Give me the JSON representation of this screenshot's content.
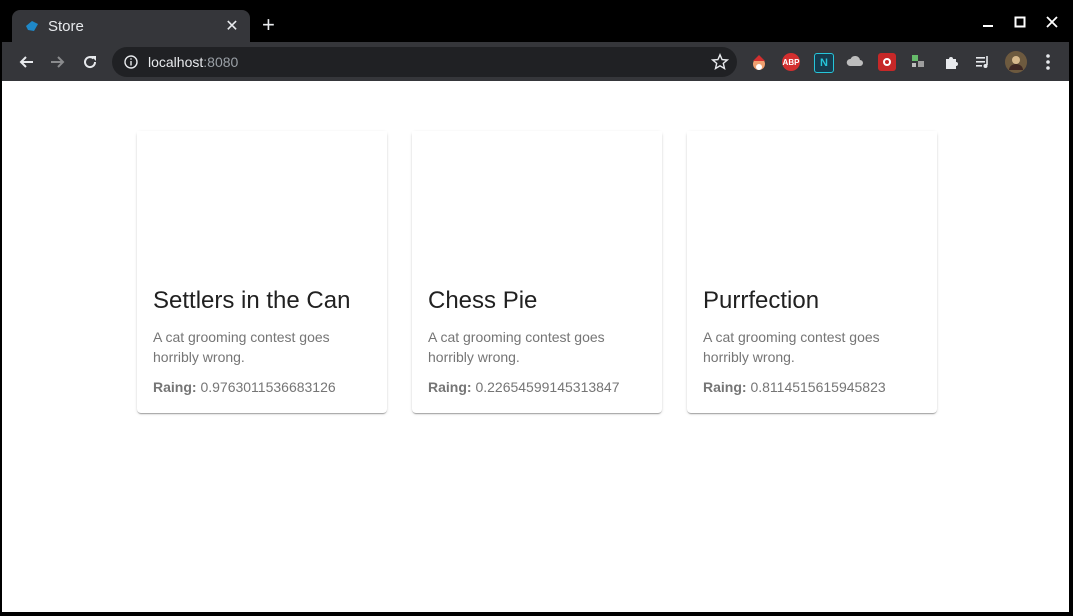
{
  "browser": {
    "tab_title": "Store",
    "tab_close": "✕",
    "new_tab": "+",
    "url_host": "localhost",
    "url_port": ":8080",
    "extensions": [
      "santa-ext-icon",
      "adblock-icon",
      "n-ext-icon",
      "cloud-ext-icon",
      "red-ext-icon",
      "s-ext-icon",
      "puzzle-icon",
      "media-queue-icon",
      "profile-avatar-icon"
    ],
    "abp_label": "ABP",
    "n_label": "N"
  },
  "products": [
    {
      "title": "Settlers in the Can",
      "description": "A cat grooming contest goes horribly wrong.",
      "rating_label": "Raing:",
      "rating_value": "0.9763011536683126"
    },
    {
      "title": "Chess Pie",
      "description": "A cat grooming contest goes horribly wrong.",
      "rating_label": "Raing:",
      "rating_value": "0.22654599145313847"
    },
    {
      "title": "Purrfection",
      "description": "A cat grooming contest goes horribly wrong.",
      "rating_label": "Raing:",
      "rating_value": "0.8114515615945823"
    }
  ]
}
